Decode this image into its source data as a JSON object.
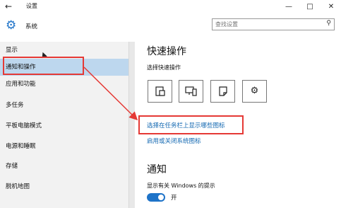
{
  "window": {
    "title": "设置",
    "back_icon": "arrow-left-icon",
    "minimize": "—",
    "maximize": "□",
    "close": "✕"
  },
  "sidebar": {
    "header": "系统",
    "items": [
      {
        "label": "显示",
        "selected": false
      },
      {
        "label": "通知和操作",
        "selected": true
      },
      {
        "label": "应用和功能",
        "selected": false
      },
      {
        "label": "多任务",
        "selected": false
      },
      {
        "label": "平板电脑模式",
        "selected": false
      },
      {
        "label": "电源和睡眠",
        "selected": false
      },
      {
        "label": "存储",
        "selected": false
      },
      {
        "label": "脱机地图",
        "selected": false
      }
    ]
  },
  "search": {
    "placeholder": "查找设置"
  },
  "main": {
    "quick_actions_title": "快速操作",
    "quick_actions_subtitle": "选择快速操作",
    "tiles": [
      "tablet-mode-icon",
      "connect-icon",
      "note-icon",
      "settings-icon"
    ],
    "link_taskbar_icons": "选择在任务栏上显示哪些图标",
    "link_system_icons": "启用或关闭系统图标",
    "notifications_title": "通知",
    "windows_tips_label": "显示有关 Windows 的提示",
    "windows_tips_state": "开",
    "windows_tips_on": true
  },
  "colors": {
    "accent": "#1e73c8",
    "link": "#1167b1",
    "selection": "#bdd7ee",
    "annotation_red": "#e53935"
  }
}
